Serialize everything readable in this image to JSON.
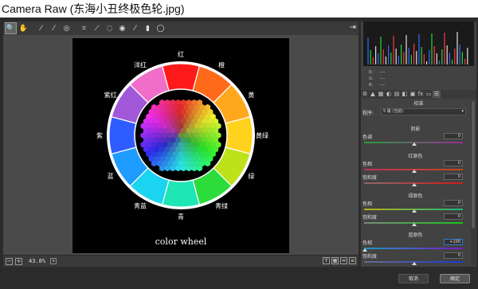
{
  "window": {
    "title": "Camera Raw (东海小丑终极色轮.jpg)"
  },
  "toolbar": {
    "tools": [
      {
        "name": "zoom-tool-icon",
        "glyph": "🔍",
        "active": true
      },
      {
        "name": "hand-tool-icon",
        "glyph": "✋"
      },
      {
        "name": "white-balance-tool-icon",
        "glyph": "⁄"
      },
      {
        "name": "color-sampler-tool-icon",
        "glyph": "⁄"
      },
      {
        "name": "targeted-adjustment-tool-icon",
        "glyph": "◎"
      },
      {
        "name": "crop-tool-icon",
        "glyph": "⌗"
      },
      {
        "name": "straighten-tool-icon",
        "glyph": "⟋"
      },
      {
        "name": "spot-removal-tool-icon",
        "glyph": "◌"
      },
      {
        "name": "red-eye-tool-icon",
        "glyph": "◉"
      },
      {
        "name": "adjustment-brush-icon",
        "glyph": "⁄"
      },
      {
        "name": "graduated-filter-icon",
        "glyph": "▮"
      },
      {
        "name": "radial-filter-icon",
        "glyph": "◯"
      }
    ],
    "open_prefs_glyph": "⇥"
  },
  "preview": {
    "caption": "color wheel",
    "zoom": "43.8%",
    "wheel_labels": [
      "红",
      "橙",
      "黄",
      "黄绿",
      "绿",
      "青绿",
      "青",
      "青蓝",
      "蓝",
      "紫",
      "紫红",
      "洋红"
    ],
    "segment_colors": [
      "#ff1a1a",
      "#ff6a1a",
      "#ffa81e",
      "#ffd21e",
      "#bde21a",
      "#2bdc3a",
      "#1ee6b4",
      "#1ad4f0",
      "#1e9cff",
      "#2f5cff",
      "#a058d8",
      "#f06ec8"
    ]
  },
  "status": {
    "left_btns": [
      "−",
      "+"
    ],
    "right_btns": [
      "Y",
      "▦",
      "⇔",
      "≡"
    ]
  },
  "rgb_readout": {
    "r_label": "R:",
    "g_label": "G:",
    "b_label": "B:",
    "r": "----",
    "g": "----",
    "b": "----"
  },
  "panel": {
    "tabs": [
      "⚙",
      "▲",
      "▦",
      "◐",
      "▤",
      "◧",
      "▣",
      "fx",
      "▭",
      "☰"
    ],
    "title": "校准",
    "process_label": "程序:",
    "process_value": "5 版 (当前)",
    "shadow": {
      "title": "阴影",
      "tint_label": "色调",
      "tint_value": "0"
    },
    "red_primary": {
      "title": "红原色",
      "hue_label": "色相",
      "hue_value": "0",
      "sat_label": "饱和度",
      "sat_value": "0"
    },
    "green_primary": {
      "title": "绿原色",
      "hue_label": "色相",
      "hue_value": "0",
      "sat_label": "饱和度",
      "sat_value": "0"
    },
    "blue_primary": {
      "title": "蓝原色",
      "hue_label": "色相",
      "hue_value": "+100",
      "sat_label": "饱和度",
      "sat_value": "0"
    },
    "colors": {
      "accent": "#2e7bd6"
    }
  },
  "buttons": {
    "cancel": "取消",
    "ok": "确定"
  }
}
